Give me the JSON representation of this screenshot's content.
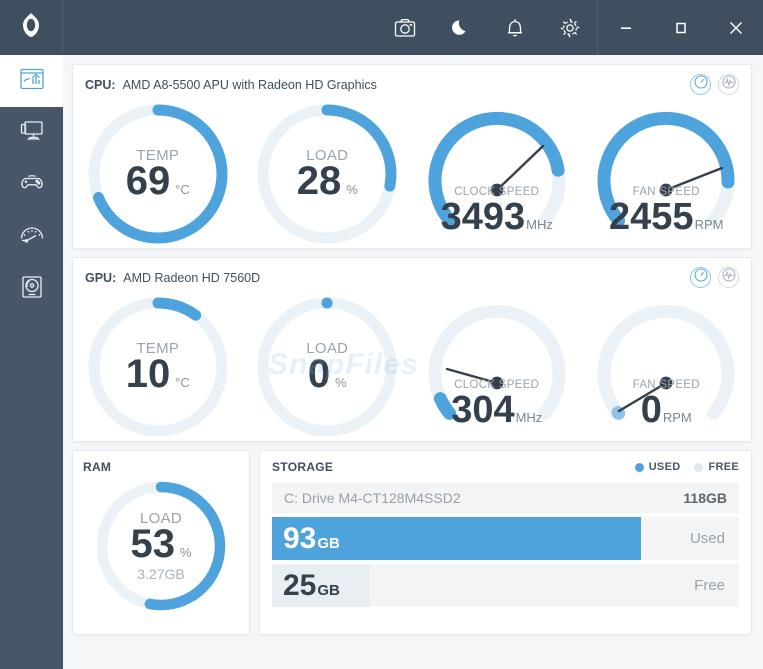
{
  "titlebar": {
    "logo_icon": "app-logo-icon",
    "buttons": [
      {
        "name": "screenshot-button",
        "icon": "camera-icon"
      },
      {
        "name": "night-mode-button",
        "icon": "moon-icon"
      },
      {
        "name": "alerts-button",
        "icon": "bell-icon"
      },
      {
        "name": "settings-button",
        "icon": "gear-icon"
      }
    ],
    "window_controls": [
      {
        "name": "minimize-button",
        "icon": "minimize-icon"
      },
      {
        "name": "maximize-button",
        "icon": "maximize-icon"
      },
      {
        "name": "close-button",
        "icon": "close-icon"
      }
    ],
    "background": "#3f4f60"
  },
  "sidebar": {
    "background": "#475769",
    "items": [
      {
        "name": "sidebar-item-dashboard",
        "icon": "dashboard-chart-icon",
        "active": true
      },
      {
        "name": "sidebar-item-pc",
        "icon": "monitor-icon",
        "active": false
      },
      {
        "name": "sidebar-item-games",
        "icon": "gamepad-icon",
        "active": false
      },
      {
        "name": "sidebar-item-benchmark",
        "icon": "speedometer-icon",
        "active": false
      },
      {
        "name": "sidebar-item-storage",
        "icon": "disk-drive-icon",
        "active": false
      }
    ]
  },
  "theme": {
    "accent": "#4fa3dc",
    "track": "#eaf2f8",
    "dark_text": "#34404c",
    "muted_text": "#9aa3ac"
  },
  "cpu": {
    "label": "CPU:",
    "name": "AMD A8-5500 APU with Radeon HD Graphics",
    "view_gauge_icon": "gauge-view-icon",
    "view_graph_icon": "waveform-view-icon",
    "temp": {
      "title": "TEMP",
      "value": "69",
      "unit": "°C",
      "percent": 69
    },
    "load": {
      "title": "LOAD",
      "value": "28",
      "unit": "%",
      "percent": 28
    },
    "clock": {
      "title": "CLOCK SPEED",
      "value": "3493",
      "unit": "MHz",
      "percent": 78
    },
    "fan": {
      "title": "FAN SPEED",
      "value": "2455",
      "unit": "RPM",
      "percent": 82
    }
  },
  "gpu": {
    "label": "GPU:",
    "name": "AMD Radeon HD 7560D",
    "view_gauge_icon": "gauge-view-icon",
    "view_graph_icon": "waveform-view-icon",
    "temp": {
      "title": "TEMP",
      "value": "10",
      "unit": "°C",
      "percent": 10
    },
    "load": {
      "title": "LOAD",
      "value": "0",
      "unit": "%",
      "percent": 0
    },
    "clock": {
      "title": "CLOCK SPEED",
      "value": "304",
      "unit": "MHz",
      "percent": 6
    },
    "fan": {
      "title": "FAN SPEED",
      "value": "0",
      "unit": "RPM",
      "percent": 0
    }
  },
  "ram": {
    "title": "RAM",
    "load": {
      "title": "LOAD",
      "value": "53",
      "unit": "%",
      "sub": "3.27GB",
      "percent": 53
    }
  },
  "storage": {
    "title": "STORAGE",
    "legend": [
      {
        "label": "USED",
        "color": "#4fa3dc"
      },
      {
        "label": "FREE",
        "color": "#dfe8ef"
      }
    ],
    "drive": {
      "name": "C: Drive M4-CT128M4SSD2",
      "size": "118GB"
    },
    "bars": [
      {
        "value": "93",
        "unit": "GB",
        "right_label": "Used",
        "percent": 79,
        "style": "used"
      },
      {
        "value": "25",
        "unit": "GB",
        "right_label": "Free",
        "percent": 21,
        "style": "free"
      }
    ]
  },
  "watermark": "SnapFiles"
}
